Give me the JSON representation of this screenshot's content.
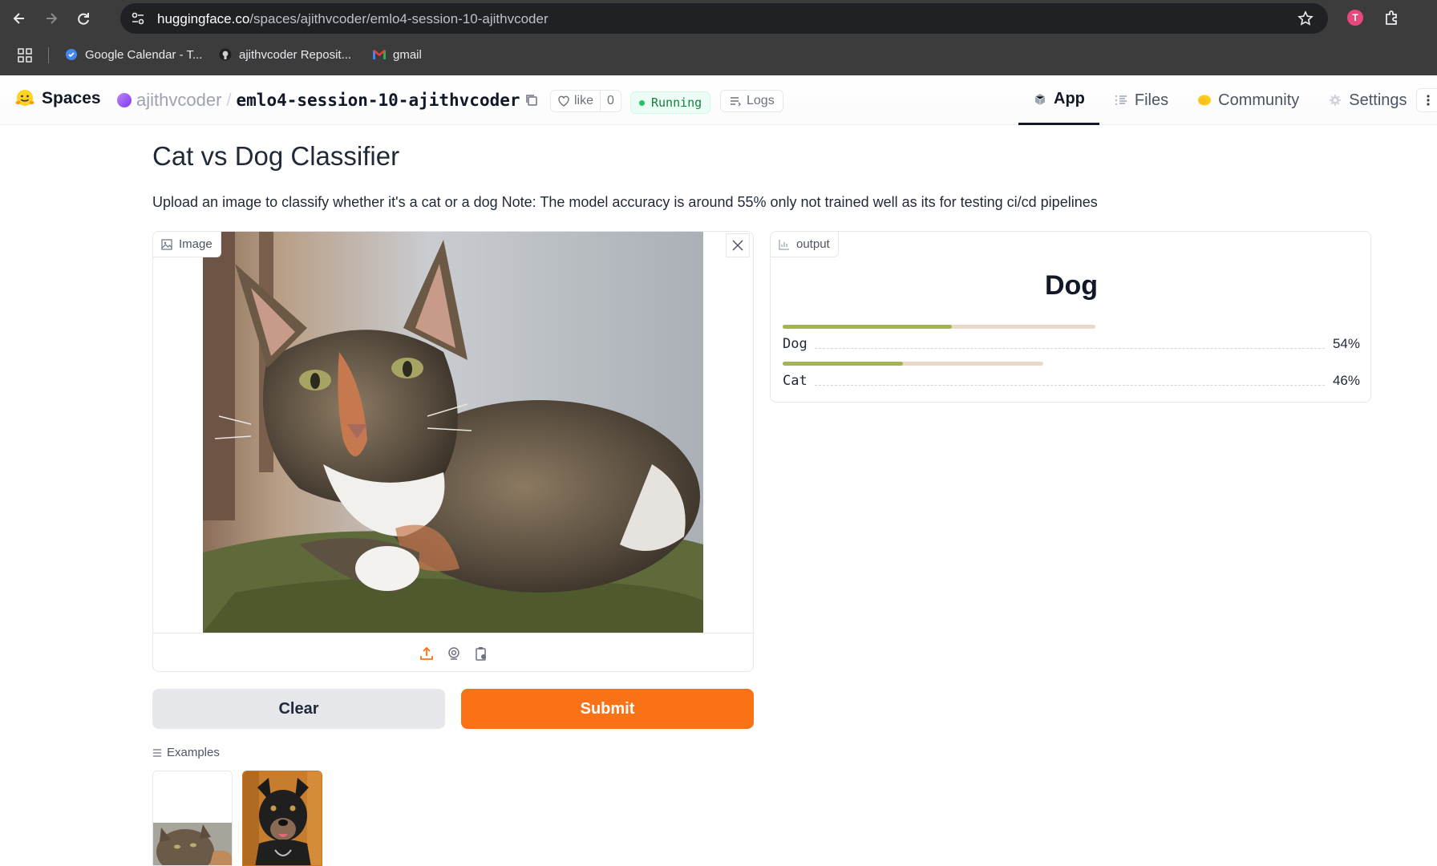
{
  "browser": {
    "url_host": "huggingface.co",
    "url_path": "/spaces/ajithvcoder/emlo4-session-10-ajithvcoder",
    "profile_initial": "T",
    "bookmarks": [
      {
        "label": "Google Calendar - T...",
        "icon": "google-calendar-icon"
      },
      {
        "label": "ajithvcoder Reposit...",
        "icon": "github-icon"
      },
      {
        "label": "gmail",
        "icon": "gmail-icon"
      }
    ]
  },
  "header": {
    "brand": "Spaces",
    "owner": "ajithvcoder",
    "separator": "/",
    "repo": "emlo4-session-10-ajithvcoder",
    "like_label": "like",
    "like_count": "0",
    "status": "Running",
    "logs_label": "Logs",
    "tabs": [
      {
        "label": "App",
        "icon": "cube-icon",
        "active": true
      },
      {
        "label": "Files",
        "icon": "files-icon",
        "active": false
      },
      {
        "label": "Community",
        "icon": "community-icon",
        "active": false
      },
      {
        "label": "Settings",
        "icon": "gear-icon",
        "active": false
      }
    ]
  },
  "app": {
    "title": "Cat vs Dog Classifier",
    "description": "Upload an image to classify whether it's a cat or a dog Note: The model accuracy is around 55% only not trained well as its for testing ci/cd pipelines",
    "image_input": {
      "label": "Image"
    },
    "output": {
      "label": "output",
      "predicted_label": "Dog",
      "confidences": [
        {
          "label": "Dog",
          "value": "54%",
          "fraction": 0.54
        },
        {
          "label": "Cat",
          "value": "46%",
          "fraction": 0.46
        }
      ]
    },
    "buttons": {
      "clear": "Clear",
      "submit": "Submit"
    },
    "examples_label": "Examples"
  },
  "colors": {
    "accent": "#f97316",
    "bar_fill": "#a3b553",
    "bar_track": "#ead9c6",
    "status_green": "#15803d"
  }
}
